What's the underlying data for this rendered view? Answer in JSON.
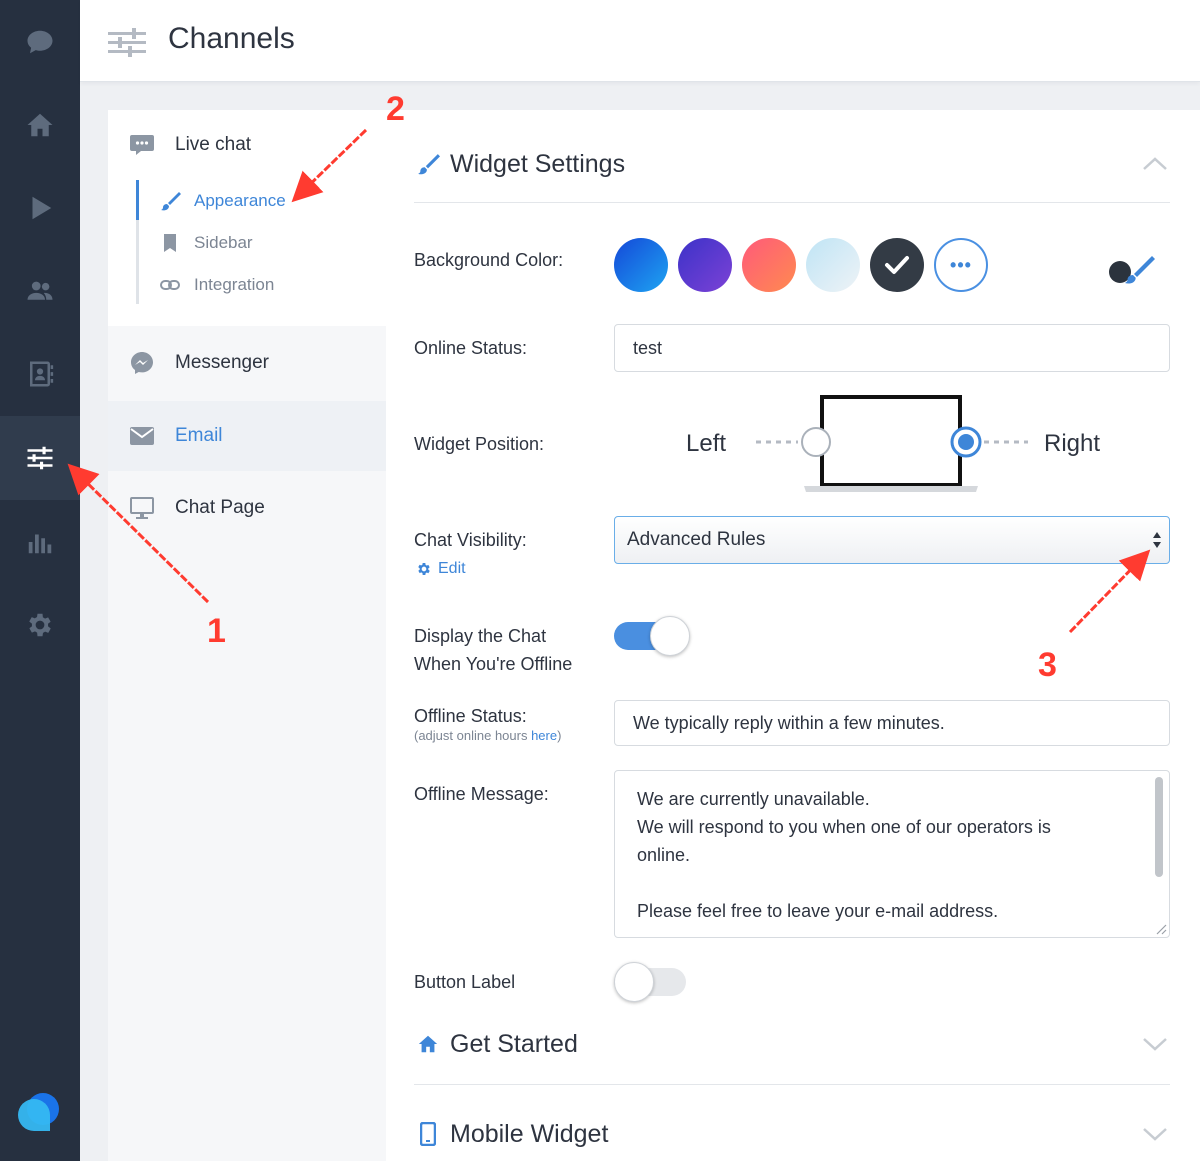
{
  "header": {
    "title": "Channels",
    "icon": "sliders-icon"
  },
  "rail": {
    "items": [
      {
        "icon": "chat-bubble-icon"
      },
      {
        "icon": "home-icon"
      },
      {
        "icon": "play-icon"
      },
      {
        "icon": "users-icon"
      },
      {
        "icon": "contacts-book-icon"
      },
      {
        "icon": "sliders-icon",
        "active": true
      },
      {
        "icon": "bar-chart-icon"
      },
      {
        "icon": "gear-icon"
      }
    ]
  },
  "subnav": {
    "live_chat": "Live chat",
    "appearance": "Appearance",
    "sidebar": "Sidebar",
    "integration": "Integration",
    "messenger": "Messenger",
    "email": "Email",
    "chat_page": "Chat Page"
  },
  "widget": {
    "title": "Widget Settings",
    "background_color_label": "Background Color:",
    "swatches": [
      "#1e6fe0",
      "#5b3cc4",
      "#ff6b6b",
      "#d6ecf6",
      "#333b45"
    ],
    "more_label": "•••",
    "online_status_label": "Online Status:",
    "online_status_value": "test",
    "widget_position_label": "Widget Position:",
    "position_left": "Left",
    "position_right": "Right",
    "position_selected": "Right",
    "chat_visibility_label": "Chat Visibility:",
    "chat_visibility_value": "Advanced Rules",
    "edit_label": "Edit",
    "display_offline_label_1": "Display the Chat",
    "display_offline_label_2": "When You're Offline",
    "display_offline_on": true,
    "offline_status_label": "Offline Status:",
    "offline_status_hint_pre": "(adjust online hours ",
    "offline_status_hint_link": "here",
    "offline_status_hint_post": ")",
    "offline_status_value": "We typically reply within a few minutes.",
    "offline_message_label": "Offline Message:",
    "offline_message_line1": "We are currently unavailable.",
    "offline_message_line2": "We will respond to you when one of our operators is",
    "offline_message_line3": "online.",
    "offline_message_line4": "Please feel free to leave your e-mail address.",
    "button_label_label": "Button Label",
    "button_label_on": false
  },
  "sections": {
    "get_started": "Get Started",
    "mobile_widget": "Mobile Widget"
  },
  "annotations": {
    "a1": "1",
    "a2": "2",
    "a3": "3"
  },
  "colors": {
    "accent": "#3e86d8",
    "rail": "#263040",
    "annotation": "#ff3b30"
  }
}
